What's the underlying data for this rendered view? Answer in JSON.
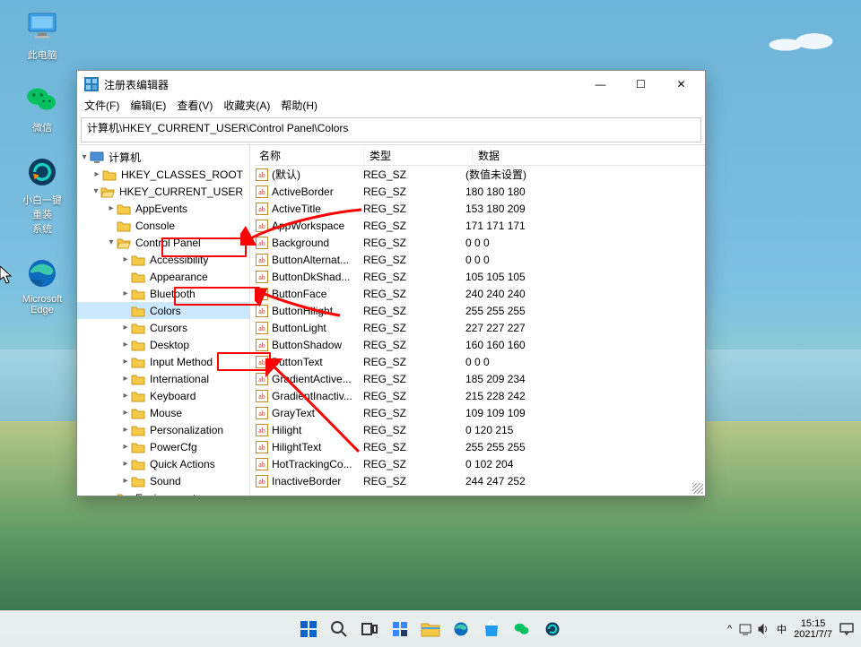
{
  "desktop_icons": [
    {
      "key": "this-pc",
      "label": "此电脑"
    },
    {
      "key": "wechat",
      "label": "微信"
    },
    {
      "key": "reinstall",
      "label": "小白一键重装\n系统"
    },
    {
      "key": "edge",
      "label": "Microsoft\nEdge"
    }
  ],
  "window": {
    "title": "注册表编辑器",
    "menu": [
      "文件(F)",
      "编辑(E)",
      "查看(V)",
      "收藏夹(A)",
      "帮助(H)"
    ],
    "address": "计算机\\HKEY_CURRENT_USER\\Control Panel\\Colors",
    "columns": {
      "name": "名称",
      "type": "类型",
      "data": "数据"
    },
    "controls": {
      "minimize": "—",
      "maximize": "☐",
      "close": "✕"
    }
  },
  "tree": {
    "root": "计算机",
    "hkcr": "HKEY_CLASSES_ROOT",
    "hkcu": "HKEY_CURRENT_USER",
    "appevents": "AppEvents",
    "console": "Console",
    "controlpanel": "Control Panel",
    "cp_children": [
      "Accessibility",
      "Appearance",
      "Bluetooth",
      "Colors",
      "Cursors",
      "Desktop",
      "Input Method",
      "International",
      "Keyboard",
      "Mouse",
      "Personalization",
      "PowerCfg",
      "Quick Actions",
      "Sound"
    ],
    "environment": "Environment"
  },
  "values": [
    {
      "name": "(默认)",
      "type": "REG_SZ",
      "data": "(数值未设置)"
    },
    {
      "name": "ActiveBorder",
      "type": "REG_SZ",
      "data": "180 180 180"
    },
    {
      "name": "ActiveTitle",
      "type": "REG_SZ",
      "data": "153 180 209"
    },
    {
      "name": "AppWorkspace",
      "type": "REG_SZ",
      "data": "171 171 171"
    },
    {
      "name": "Background",
      "type": "REG_SZ",
      "data": "0 0 0"
    },
    {
      "name": "ButtonAlternat...",
      "type": "REG_SZ",
      "data": "0 0 0"
    },
    {
      "name": "ButtonDkShad...",
      "type": "REG_SZ",
      "data": "105 105 105"
    },
    {
      "name": "ButtonFace",
      "type": "REG_SZ",
      "data": "240 240 240"
    },
    {
      "name": "ButtonHilight",
      "type": "REG_SZ",
      "data": "255 255 255"
    },
    {
      "name": "ButtonLight",
      "type": "REG_SZ",
      "data": "227 227 227"
    },
    {
      "name": "ButtonShadow",
      "type": "REG_SZ",
      "data": "160 160 160"
    },
    {
      "name": "ButtonText",
      "type": "REG_SZ",
      "data": "0 0 0"
    },
    {
      "name": "GradientActive...",
      "type": "REG_SZ",
      "data": "185 209 234"
    },
    {
      "name": "GradientInactiv...",
      "type": "REG_SZ",
      "data": "215 228 242"
    },
    {
      "name": "GrayText",
      "type": "REG_SZ",
      "data": "109 109 109"
    },
    {
      "name": "Hilight",
      "type": "REG_SZ",
      "data": "0 120 215"
    },
    {
      "name": "HilightText",
      "type": "REG_SZ",
      "data": "255 255 255"
    },
    {
      "name": "HotTrackingCo...",
      "type": "REG_SZ",
      "data": "0 102 204"
    },
    {
      "name": "InactiveBorder",
      "type": "REG_SZ",
      "data": "244 247 252"
    }
  ],
  "systray": {
    "chevron": "^",
    "ime": "中",
    "time": "15:15",
    "date": "2021/7/7"
  }
}
